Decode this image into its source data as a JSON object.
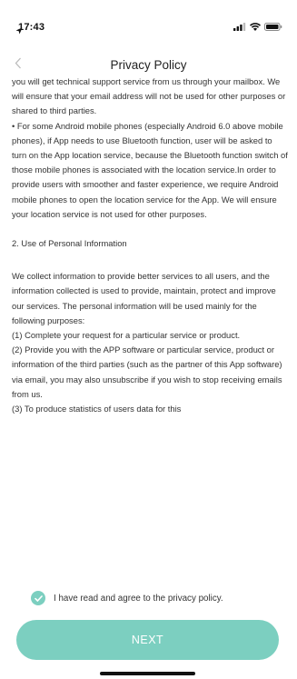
{
  "status_bar": {
    "time": "17:43",
    "icons": [
      "location-arrow-icon",
      "signal-icon",
      "wifi-icon",
      "battery-icon"
    ]
  },
  "nav": {
    "title": "Privacy Policy",
    "back_icon": "chevron-left-icon"
  },
  "policy": {
    "paragraphs": [
      "you will get technical support service from us through your mailbox. We will ensure that your email address will not be used for other purposes or shared to third parties.\n• For some Android mobile phones (especially Android 6.0 above mobile phones), if App needs to use Bluetooth function, user will be asked to turn on the App location service, because the Bluetooth function switch of those mobile phones is associated with the location service.In order to provide users with smoother and faster experience, we require Android mobile phones to open the location service for the App. We will ensure your location service is not used for other purposes.",
      "2. Use of Personal Information",
      "We collect information to provide better services to all users, and the information collected is used to provide, maintain, protect and improve our services. The personal information will be used mainly for the following purposes:\n(1) Complete your request for a particular service or product.\n(2) Provide you with the APP software or particular service, product or information of the third parties (such as the partner of this App software) via email, you may also unsubscribe if you wish to stop receiving emails from us.\n(3) To produce statistics of users data for this"
    ]
  },
  "agreement": {
    "checked": true,
    "label": "I have read and agree to the privacy policy."
  },
  "next_button": {
    "label": "NEXT"
  },
  "colors": {
    "accent": "#7ccfc0",
    "text": "#333333",
    "background": "#ffffff"
  }
}
